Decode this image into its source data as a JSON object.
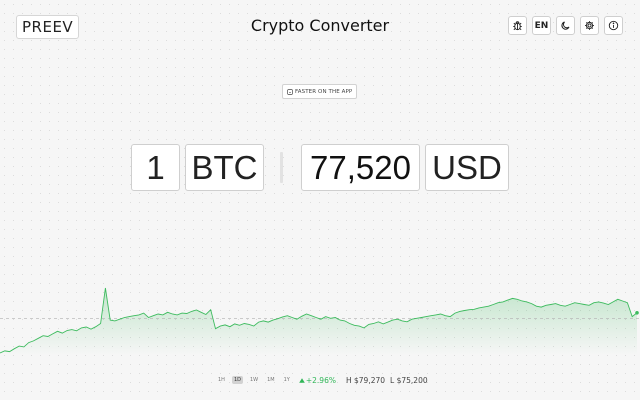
{
  "header": {
    "logo": "PREEV",
    "title": "Crypto Converter",
    "language": "EN",
    "icons": [
      "bug-icon",
      "moon-icon",
      "gear-icon",
      "info-icon"
    ]
  },
  "promo": {
    "label": "FASTER ON THE APP",
    "icon": "phone-icon"
  },
  "converter": {
    "amount": "1",
    "from": "BTC",
    "result": "77,520",
    "to": "USD"
  },
  "chart_data": {
    "type": "area",
    "color": "#3dbb5e",
    "values": [
      75200,
      75320,
      75280,
      75450,
      75600,
      75550,
      75800,
      75900,
      76050,
      76200,
      76150,
      76300,
      76450,
      76350,
      76500,
      76550,
      76480,
      76650,
      76700,
      76580,
      76720,
      76900,
      78950,
      77100,
      77050,
      77150,
      77250,
      77300,
      77350,
      77400,
      77500,
      77250,
      77350,
      77450,
      77400,
      77550,
      77450,
      77400,
      77500,
      77480,
      77600,
      77680,
      77550,
      77420,
      77700,
      76600,
      76750,
      76820,
      76720,
      76880,
      76800,
      76900,
      76850,
      76760,
      76980,
      77050,
      76980,
      77100,
      77180,
      77280,
      77350,
      77250,
      77150,
      77320,
      77450,
      77350,
      77250,
      77150,
      77300,
      77200,
      77250,
      77100,
      77050,
      76900,
      76800,
      76750,
      76650,
      76850,
      76900,
      77000,
      76880,
      76980,
      77100,
      77150,
      77050,
      77000,
      77150,
      77200,
      77250,
      77300,
      77350,
      77400,
      77450,
      77350,
      77300,
      77500,
      77600,
      77650,
      77700,
      77720,
      77800,
      77850,
      77900,
      78000,
      78100,
      78150,
      78250,
      78350,
      78300,
      78200,
      78150,
      78050,
      77900,
      77850,
      77950,
      78000,
      78050,
      77950,
      77900,
      78000,
      78100,
      78050,
      78000,
      77950,
      78100,
      78150,
      78080,
      78000,
      78150,
      78300,
      78200,
      78100,
      77300,
      77520
    ],
    "reference": 77200,
    "range": "1D"
  },
  "footer": {
    "ranges": [
      "1H",
      "1D",
      "1W",
      "1M",
      "1Y"
    ],
    "active": "1D",
    "change": "+2.96%",
    "high": "H $79,270",
    "low": "L $75,200"
  }
}
